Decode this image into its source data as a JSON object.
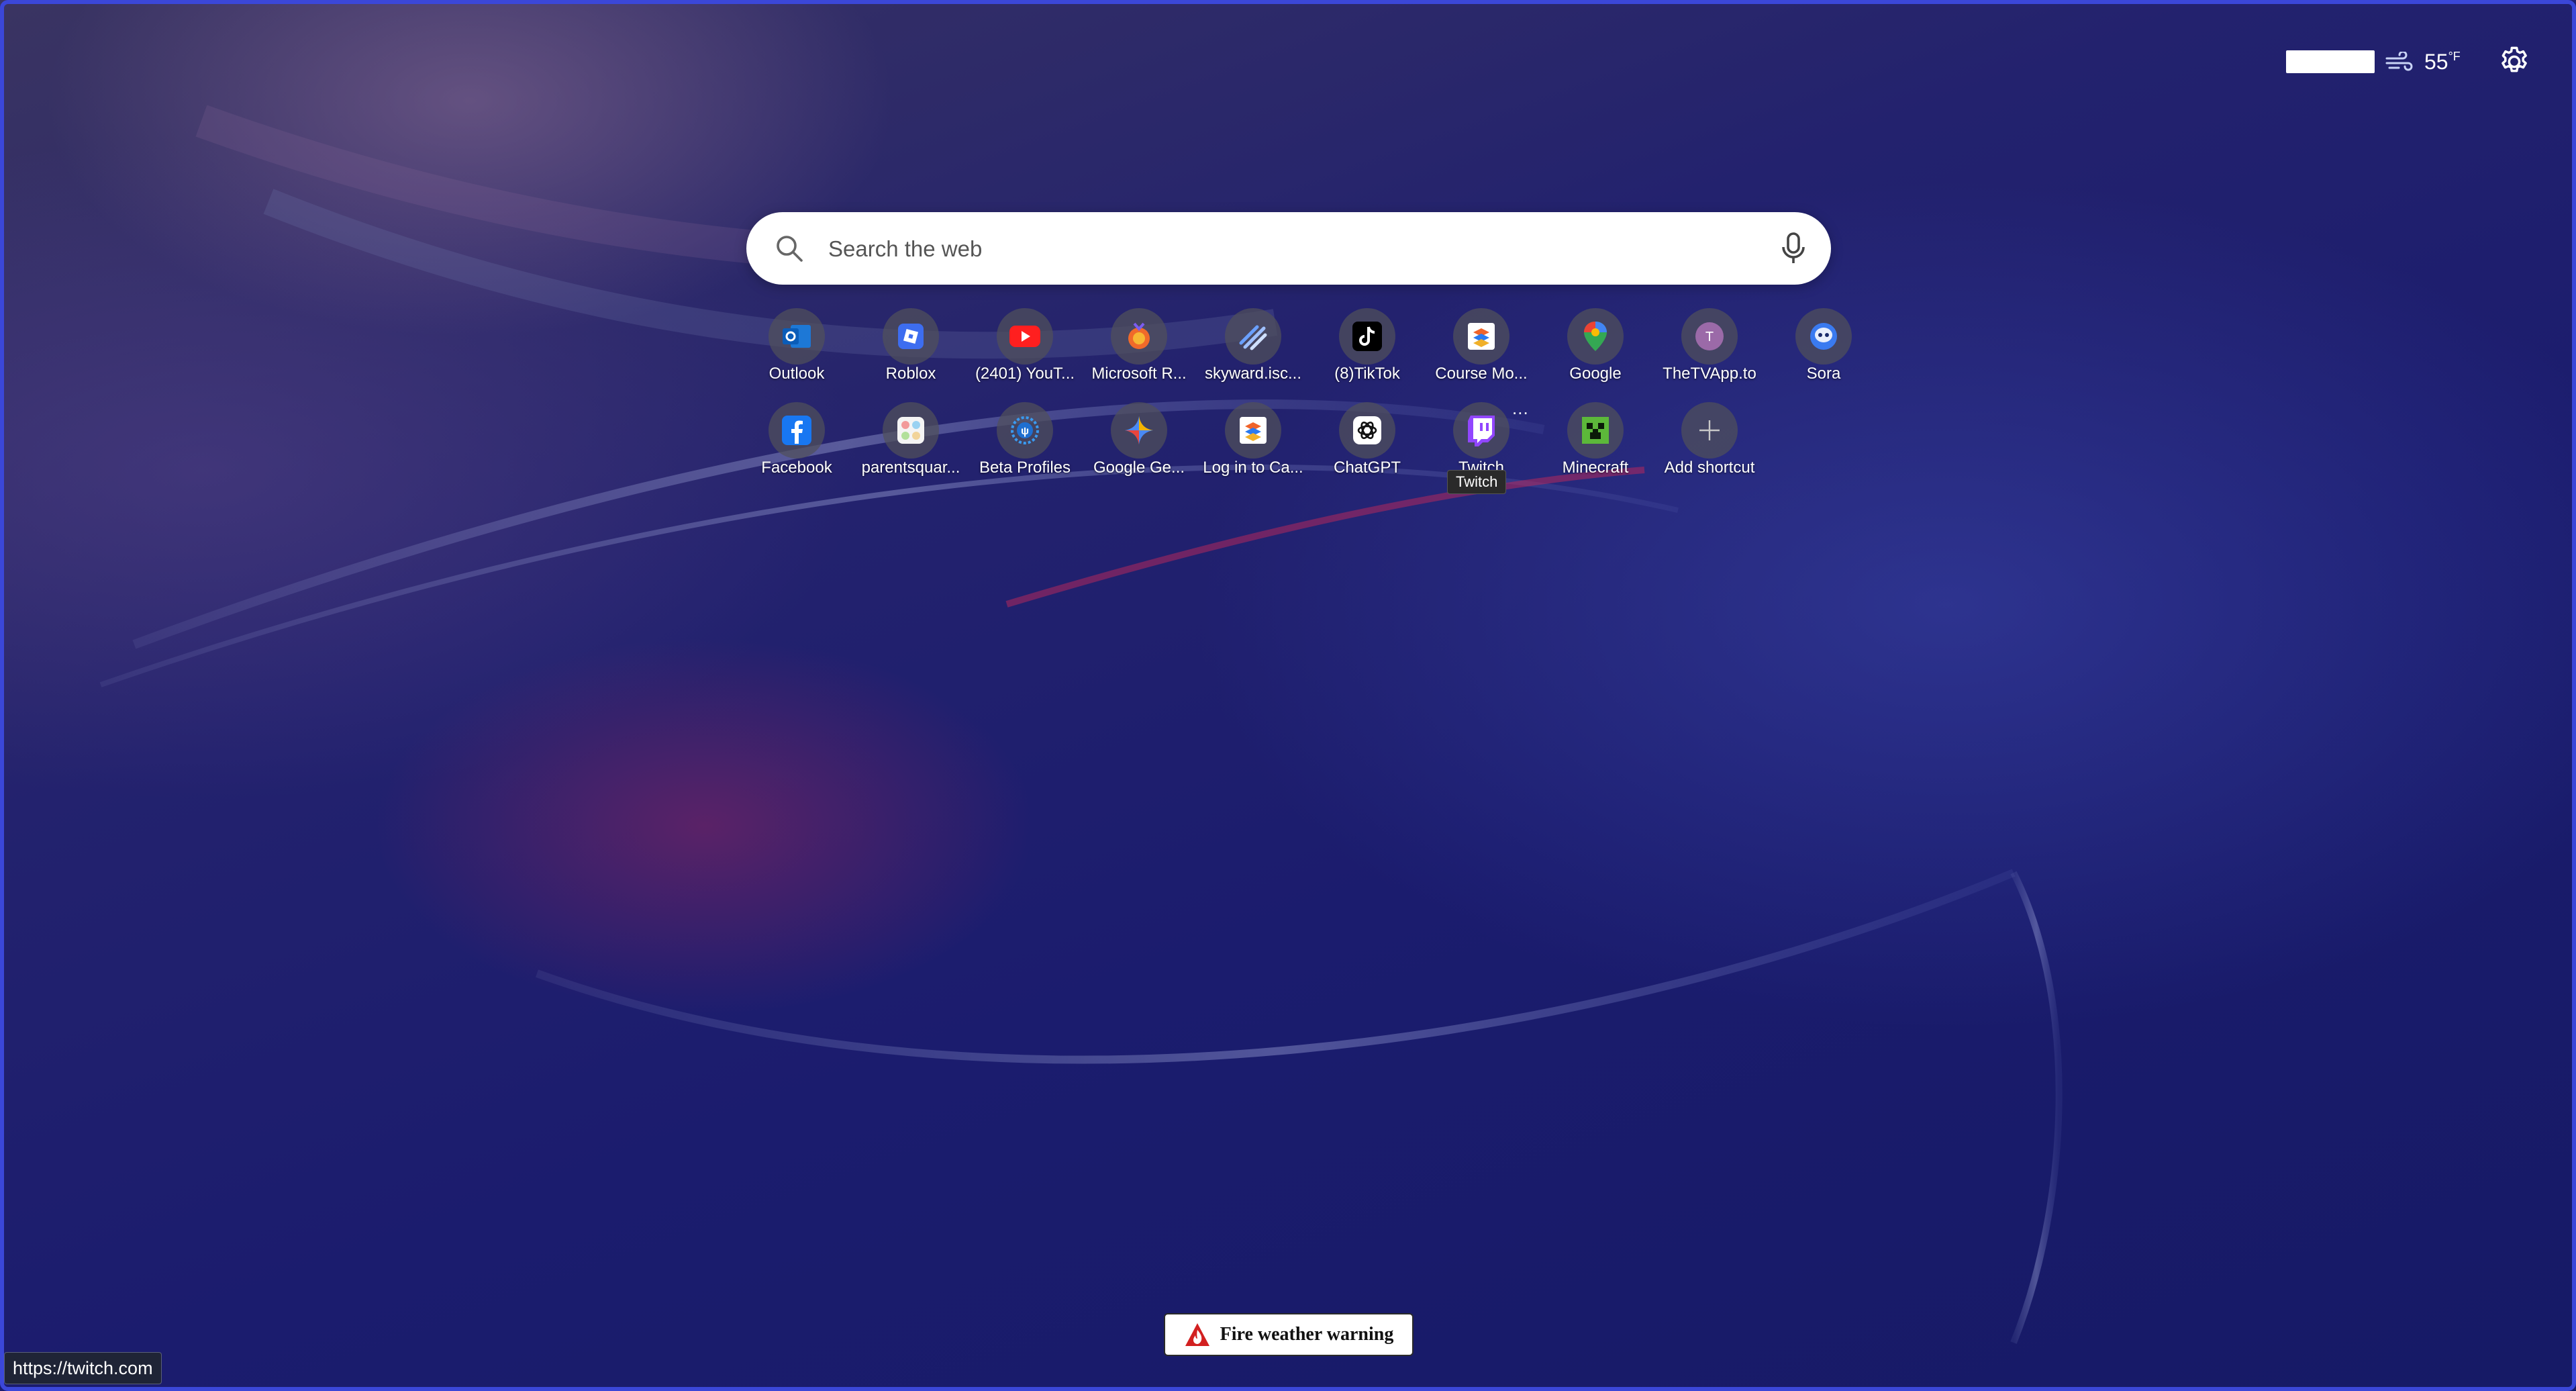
{
  "weather": {
    "temperature": "55",
    "unit": "°F",
    "condition_icon": "wind-icon"
  },
  "search": {
    "placeholder": "Search the web"
  },
  "shortcuts": [
    {
      "label": "Outlook",
      "icon": "outlook-icon"
    },
    {
      "label": "Roblox",
      "icon": "roblox-icon"
    },
    {
      "label": "(2401) YouT...",
      "icon": "youtube-icon"
    },
    {
      "label": "Microsoft R...",
      "icon": "microsoft-rewards-icon"
    },
    {
      "label": "skyward.isc...",
      "icon": "skyward-icon"
    },
    {
      "label": "(8)TikTok",
      "icon": "tiktok-icon"
    },
    {
      "label": "Course Mo...",
      "icon": "canvas-icon"
    },
    {
      "label": "Google",
      "icon": "google-maps-icon"
    },
    {
      "label": "TheTVApp.to",
      "icon": "letter-t-icon",
      "letter": "T"
    },
    {
      "label": "Sora",
      "icon": "sora-icon"
    },
    {
      "label": "Facebook",
      "icon": "facebook-icon"
    },
    {
      "label": "parentsquar...",
      "icon": "parentsquare-icon"
    },
    {
      "label": "Beta Profiles",
      "icon": "beta-profiles-icon"
    },
    {
      "label": "Google Ge...",
      "icon": "gemini-icon"
    },
    {
      "label": "Log in to Ca...",
      "icon": "canvas-icon"
    },
    {
      "label": "ChatGPT",
      "icon": "chatgpt-icon"
    },
    {
      "label": "Twitch",
      "icon": "twitch-icon"
    },
    {
      "label": "Minecraft",
      "icon": "minecraft-icon"
    },
    {
      "label": "Add shortcut",
      "icon": "plus-icon"
    }
  ],
  "tooltip": "Twitch",
  "more_menu": "...",
  "alert": {
    "text": "Fire weather warning",
    "icon": "fire-warning-icon"
  },
  "status_url": "https://twitch.com",
  "colors": {
    "frame": "#3b47d8",
    "background": "#1b1c6e",
    "search_bg": "#ffffff"
  }
}
